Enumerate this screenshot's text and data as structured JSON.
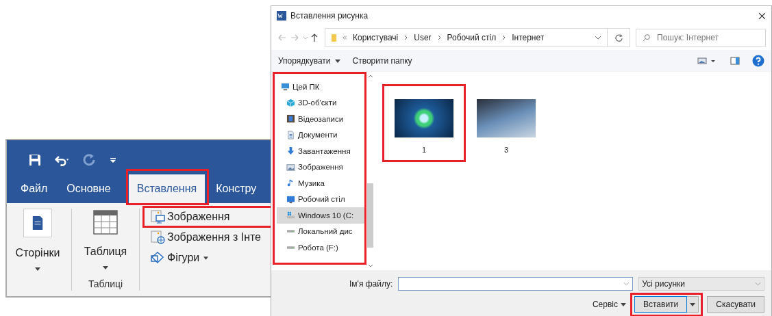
{
  "word": {
    "tabs": [
      {
        "label": "Файл",
        "selected": false,
        "highlighted": false
      },
      {
        "label": "Основне",
        "selected": false,
        "highlighted": false
      },
      {
        "label": "Вставлення",
        "selected": true,
        "highlighted": true
      },
      {
        "label": "Констру",
        "selected": false,
        "highlighted": false
      }
    ],
    "ribbon": {
      "pages_button": "Сторінки",
      "table_button": "Таблиця",
      "table_group_label": "Таблиці",
      "commands": [
        {
          "label": "Зображення",
          "kind": "picture",
          "dropdown": false,
          "highlighted": true
        },
        {
          "label": "Зображення з Інте",
          "kind": "online-picture",
          "dropdown": false,
          "highlighted": false
        },
        {
          "label": "Фігури",
          "kind": "shapes",
          "dropdown": true,
          "highlighted": false
        }
      ]
    }
  },
  "dialog": {
    "title": "Вставлення рисунка",
    "breadcrumbs": [
      "Користувачі",
      "User",
      "Робочий стіл",
      "Інтернет"
    ],
    "search": {
      "placeholder": "Пошук: Інтернет"
    },
    "toolbar": {
      "organize": "Упорядкувати",
      "new_folder": "Створити папку"
    },
    "nav": {
      "highlighted": true,
      "items": [
        {
          "label": "Цей ПК",
          "kind": "pc",
          "selected": false,
          "children": [
            {
              "label": "3D-об'єкти",
              "kind": "cube",
              "selected": false
            },
            {
              "label": "Відеозаписи",
              "kind": "video",
              "selected": false
            },
            {
              "label": "Документи",
              "kind": "document",
              "selected": false
            },
            {
              "label": "Завантаження",
              "kind": "download",
              "selected": false
            },
            {
              "label": "Зображення",
              "kind": "pictures",
              "selected": false
            },
            {
              "label": "Музика",
              "kind": "music",
              "selected": false
            },
            {
              "label": "Робочий стіл",
              "kind": "desktop",
              "selected": false
            },
            {
              "label": "Windows 10 (C:",
              "kind": "system-drive",
              "selected": true
            },
            {
              "label": "Локальний дис",
              "kind": "drive",
              "selected": false
            },
            {
              "label": "Робота (F:)",
              "kind": "drive",
              "selected": false
            }
          ]
        }
      ]
    },
    "files": [
      {
        "name": "1",
        "highlighted": true
      },
      {
        "name": "3",
        "highlighted": false
      }
    ],
    "filename_label": "Ім'я файлу:",
    "filter": "Усі рисунки",
    "tools": "Сервіс",
    "insert": {
      "label": "Вставити",
      "highlighted": true
    },
    "cancel": "Скасувати"
  }
}
